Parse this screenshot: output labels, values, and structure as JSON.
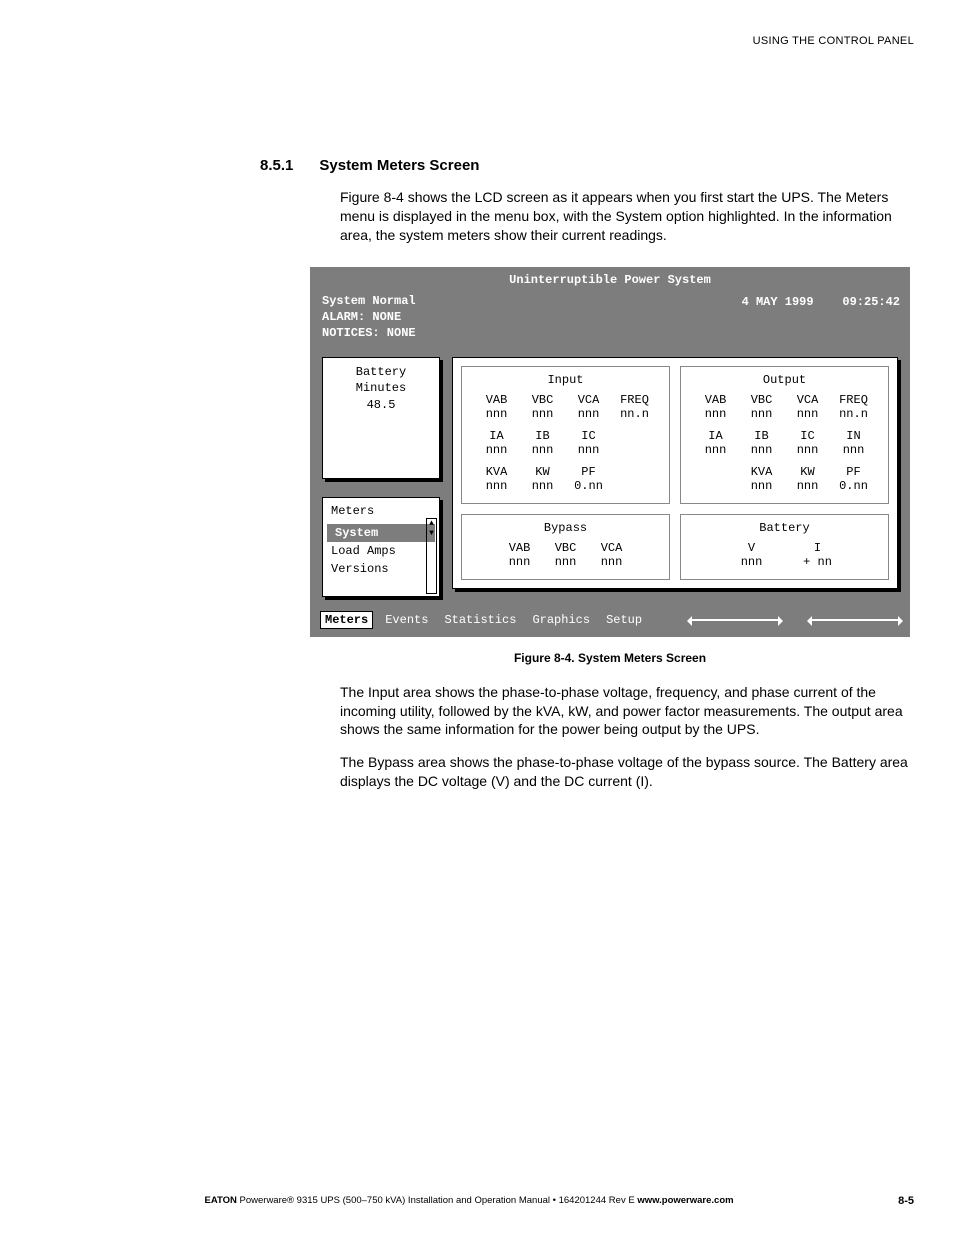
{
  "header": {
    "context": "USING THE CONTROL PANEL"
  },
  "section": {
    "number": "8.5.1",
    "title": "System Meters Screen"
  },
  "para1": "Figure 8-4 shows the LCD screen as it appears when you first start the UPS. The Meters menu is displayed in the menu box, with the System option highlighted. In the information area, the system meters show their current readings.",
  "lcd": {
    "title": "Uninterruptible Power System",
    "status": {
      "line1": "System Normal",
      "line2": "ALARM:  NONE",
      "line3": "NOTICES: NONE"
    },
    "date": "4 MAY 1999",
    "time": "09:25:42",
    "battery": {
      "label": "Battery\nMinutes",
      "value": "48.5"
    },
    "menu": {
      "title": "Meters",
      "items": [
        "System",
        "Load Amps",
        "Versions"
      ],
      "selected": 0
    },
    "input": {
      "title": "Input",
      "r1h": [
        "VAB",
        "VBC",
        "VCA",
        "FREQ"
      ],
      "r1v": [
        "nnn",
        "nnn",
        "nnn",
        "nn.n"
      ],
      "r2h": [
        "IA",
        "IB",
        "IC",
        ""
      ],
      "r2v": [
        "nnn",
        "nnn",
        "nnn",
        ""
      ],
      "r3h": [
        "KVA",
        "KW",
        "PF",
        ""
      ],
      "r3v": [
        "nnn",
        "nnn",
        "0.nn",
        ""
      ]
    },
    "output": {
      "title": "Output",
      "r1h": [
        "VAB",
        "VBC",
        "VCA",
        "FREQ"
      ],
      "r1v": [
        "nnn",
        "nnn",
        "nnn",
        "nn.n"
      ],
      "r2h": [
        "IA",
        "IB",
        "IC",
        "IN"
      ],
      "r2v": [
        "nnn",
        "nnn",
        "nnn",
        "nnn"
      ],
      "r3h": [
        "",
        "KVA",
        "KW",
        "PF"
      ],
      "r3v": [
        "",
        "nnn",
        "nnn",
        "0.nn"
      ]
    },
    "bypass": {
      "title": "Bypass",
      "r1h": [
        "VAB",
        "VBC",
        "VCA"
      ],
      "r1v": [
        "nnn",
        "nnn",
        "nnn"
      ]
    },
    "batteryPanel": {
      "title": "Battery",
      "r1h": [
        "V",
        "I"
      ],
      "r1v": [
        "nnn",
        "+ nn"
      ]
    },
    "bottom": {
      "items": [
        "Meters",
        "Events",
        "Statistics",
        "Graphics",
        "Setup"
      ],
      "selected": 0
    }
  },
  "figure_caption": "Figure 8-4. System Meters Screen",
  "para2": "The Input area shows the phase-to-phase voltage, frequency, and phase current of the incoming utility, followed by the kVA, kW, and power factor measurements. The output area shows the same information for the power being output by the UPS.",
  "para3": "The Bypass area shows the phase-to-phase voltage of the bypass source. The Battery area displays the DC voltage (V) and the DC current (I).",
  "footer": {
    "brand_bold": "EATON",
    "text1": " Powerware® 9315 UPS (500–750 kVA) Installation and Operation Manual ",
    "bullet": "•",
    "text2": " 164201244 Rev E ",
    "url": "www.powerware.com",
    "pagenum": "8-5"
  }
}
